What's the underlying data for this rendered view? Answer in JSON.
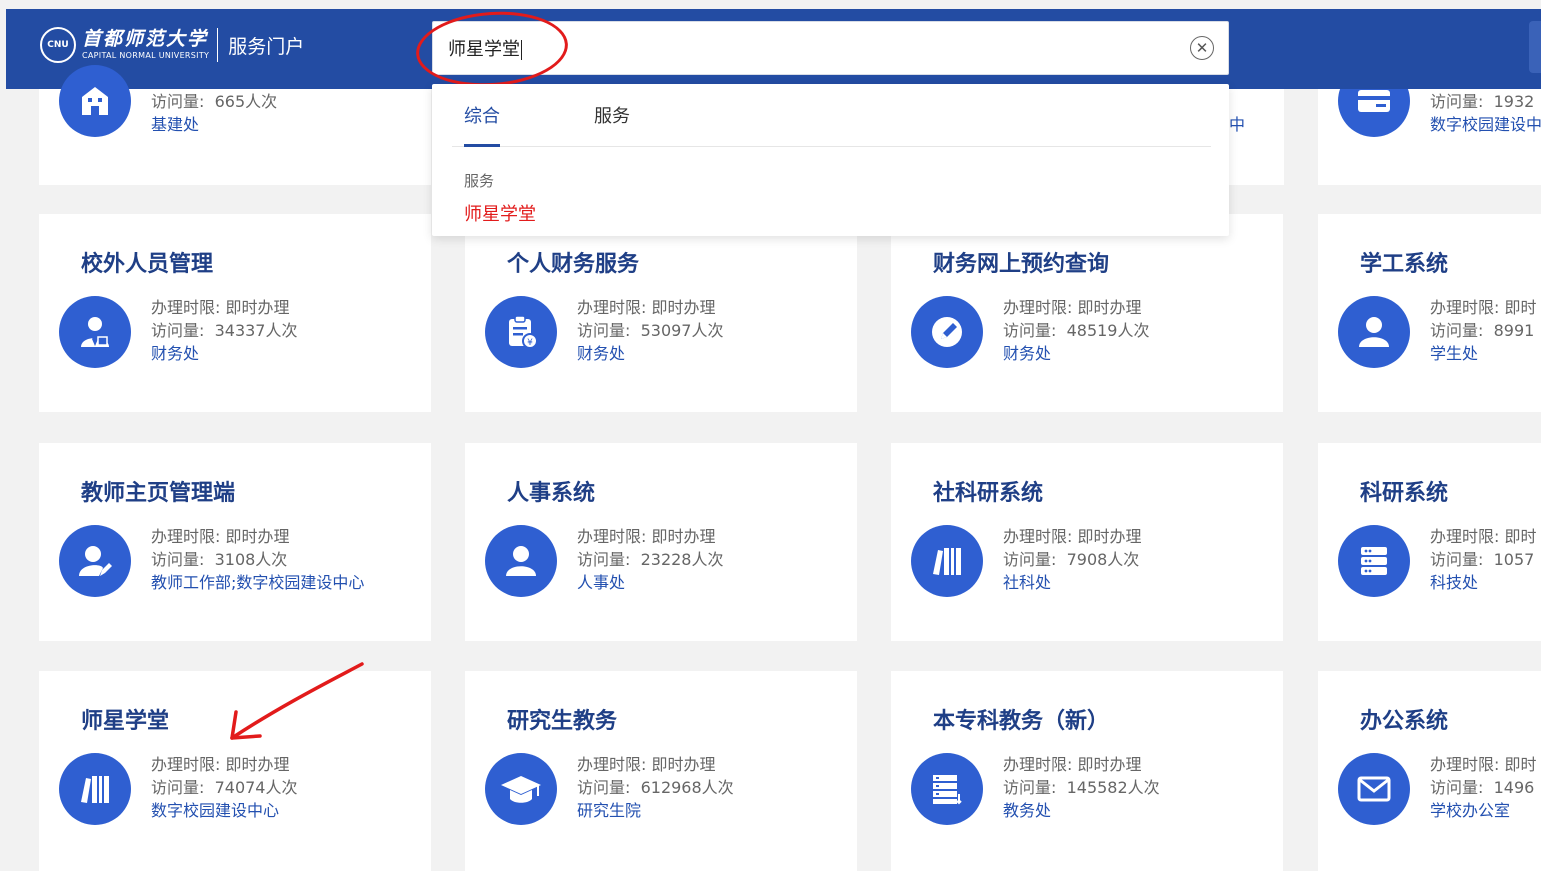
{
  "header": {
    "logo_seal": "CNU",
    "logo_cn": "首都师范大学",
    "logo_en": "CAPITAL NORMAL UNIVERSITY",
    "portal_label": "服务门户"
  },
  "search": {
    "value": "师星学堂",
    "clear_symbol": "✕",
    "tabs": [
      "综合",
      "服务"
    ],
    "section_label": "服务",
    "result": "师星学堂"
  },
  "labels": {
    "time_limit_prefix": "办理时限:",
    "visits_prefix": "访问量:"
  },
  "top_row": [
    {
      "visits": "665人次",
      "dept": "基建处"
    },
    {
      "visits": "",
      "dept": "中"
    },
    {
      "visits": "1932",
      "dept": "数字校园建设中"
    }
  ],
  "cards": [
    {
      "title": "校外人员管理",
      "time_limit": "即时办理",
      "visits": "34337人次",
      "dept": "财务处",
      "icon": "user-tie-icon"
    },
    {
      "title": "个人财务服务",
      "time_limit": "即时办理",
      "visits": "53097人次",
      "dept": "财务处",
      "icon": "finance-doc-icon"
    },
    {
      "title": "财务网上预约查询",
      "time_limit": "即时办理",
      "visits": "48519人次",
      "dept": "财务处",
      "icon": "edit-pen-icon"
    },
    {
      "title": "学工系统",
      "time_limit": "即时",
      "visits": "8991",
      "dept": "学生处",
      "icon": "user-icon"
    },
    {
      "title": "教师主页管理端",
      "time_limit": "即时办理",
      "visits": "3108人次",
      "dept": "教师工作部;数字校园建设中心",
      "icon": "user-edit-icon"
    },
    {
      "title": "人事系统",
      "time_limit": "即时办理",
      "visits": "23228人次",
      "dept": "人事处",
      "icon": "user-icon"
    },
    {
      "title": "社科研系统",
      "time_limit": "即时办理",
      "visits": "7908人次",
      "dept": "社科处",
      "icon": "books-icon"
    },
    {
      "title": "科研系统",
      "time_limit": "即时",
      "visits": "1057",
      "dept": "科技处",
      "icon": "server-icon"
    },
    {
      "title": "师星学堂",
      "time_limit": "即时办理",
      "visits": "74074人次",
      "dept": "数字校园建设中心",
      "icon": "books-icon"
    },
    {
      "title": "研究生教务",
      "time_limit": "即时办理",
      "visits": "612968人次",
      "dept": "研究生院",
      "icon": "graduation-cap-icon"
    },
    {
      "title": "本专科教务（新）",
      "time_limit": "即时办理",
      "visits": "145582人次",
      "dept": "教务处",
      "icon": "server-rack-icon"
    },
    {
      "title": "办公系统",
      "time_limit": "即时",
      "visits": "1496",
      "dept": "学校办公室",
      "icon": "mail-icon"
    }
  ]
}
